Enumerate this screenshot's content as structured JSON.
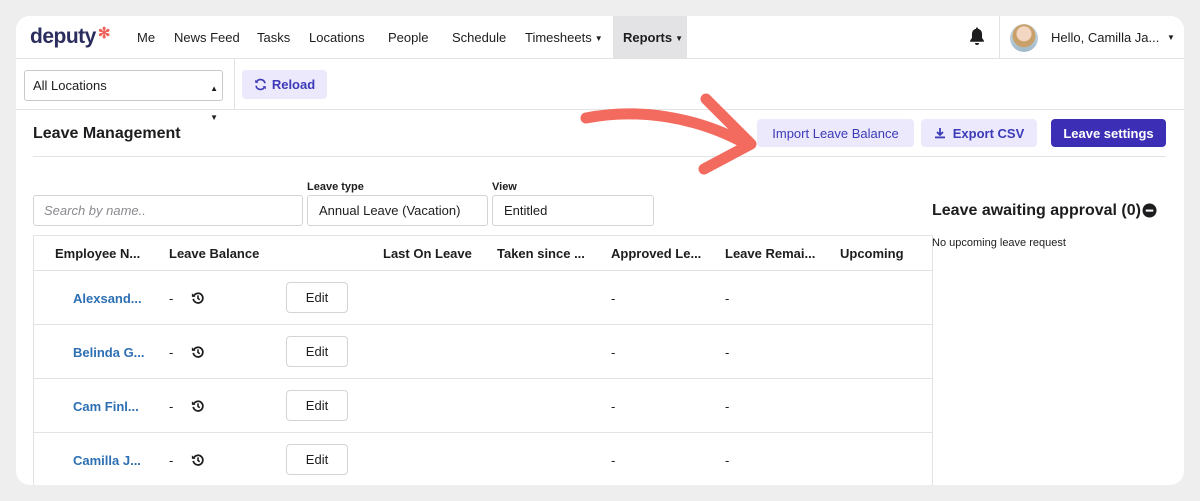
{
  "nav": {
    "logo": "deputy",
    "items": [
      "Me",
      "News Feed",
      "Tasks",
      "Locations",
      "People",
      "Schedule",
      "Timesheets",
      "Reports"
    ],
    "active": "Reports",
    "greeting": "Hello, Camilla Ja..."
  },
  "toolbar": {
    "location_value": "All Locations",
    "reload_label": "Reload"
  },
  "page": {
    "title": "Leave Management",
    "import_label": "Import Leave Balance",
    "export_label": "Export CSV",
    "settings_label": "Leave settings"
  },
  "filters": {
    "search_placeholder": "Search by name..",
    "leave_type_label": "Leave type",
    "leave_type_value": "Annual Leave (Vacation)",
    "view_label": "View",
    "view_value": "Entitled"
  },
  "table": {
    "headers": [
      "Employee N...",
      "Leave Balance (",
      "Last On Leave",
      "Taken since ...",
      "Approved Le...",
      "Leave Remai...",
      "Upcoming"
    ],
    "rows": [
      {
        "name": "Alexsand...",
        "balance": "-",
        "edit": "Edit",
        "approved": "-",
        "remaining": "-"
      },
      {
        "name": "Belinda G...",
        "balance": "-",
        "edit": "Edit",
        "approved": "-",
        "remaining": "-"
      },
      {
        "name": "Cam Finl...",
        "balance": "-",
        "edit": "Edit",
        "approved": "-",
        "remaining": "-"
      },
      {
        "name": "Camilla J...",
        "balance": "-",
        "edit": "Edit",
        "approved": "-",
        "remaining": "-"
      }
    ]
  },
  "approval": {
    "title": "Leave awaiting approval (0)",
    "empty_text": "No upcoming leave request"
  },
  "colors": {
    "accent": "#3d2fb5",
    "accent_light": "#ebe9fb",
    "link": "#2d6fb3",
    "annotation": "#f26b5e"
  }
}
